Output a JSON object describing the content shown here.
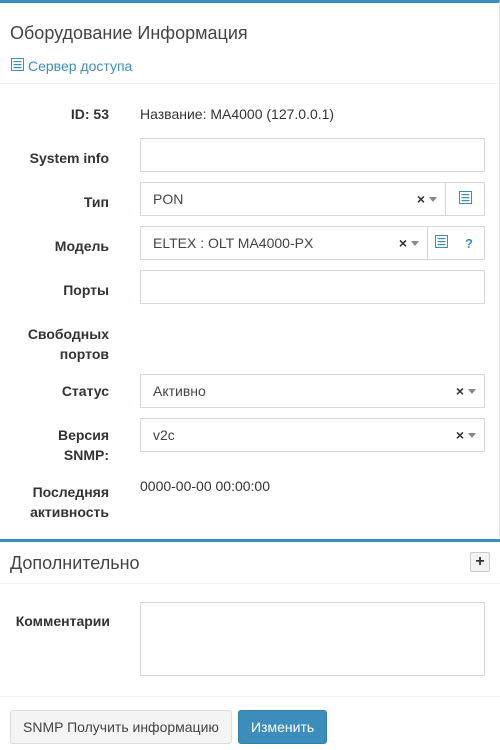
{
  "equipment_panel": {
    "title": "Оборудование Информация",
    "access_server_link": "Сервер доступа",
    "id_label": "ID: 53",
    "name_value": "Название: MA4000 (127.0.0.1)",
    "system_info_label": "System info",
    "system_info_value": "",
    "type_label": "Тип",
    "type_value": "PON",
    "model_label": "Модель",
    "model_value": "ELTEX : OLT MA4000-PX",
    "model_help": "?",
    "ports_label": "Порты",
    "ports_value": "",
    "free_ports_label_1": "Свободных",
    "free_ports_label_2": "портов",
    "status_label": "Статус",
    "status_value": "Активно",
    "snmp_version_label_1": "Версия",
    "snmp_version_label_2": "SNMP:",
    "snmp_version_value": "v2c",
    "last_activity_label_1": "Последняя",
    "last_activity_label_2": "активность",
    "last_activity_value": "0000-00-00 00:00:00",
    "clear_symbol": "×"
  },
  "additional_panel": {
    "title": "Дополнительно",
    "expand_symbol": "+",
    "comments_label": "Комментарии",
    "comments_value": ""
  },
  "actions": {
    "snmp_button": "SNMP Получить информацию",
    "submit_button": "Изменить"
  },
  "colors": {
    "accent": "#3c8dbc",
    "border": "#d2d6de"
  },
  "icons": {
    "list": "list-icon",
    "help": "question-icon",
    "clear": "clear-icon",
    "dropdown": "chevron-down-icon",
    "expand": "plus-icon"
  }
}
